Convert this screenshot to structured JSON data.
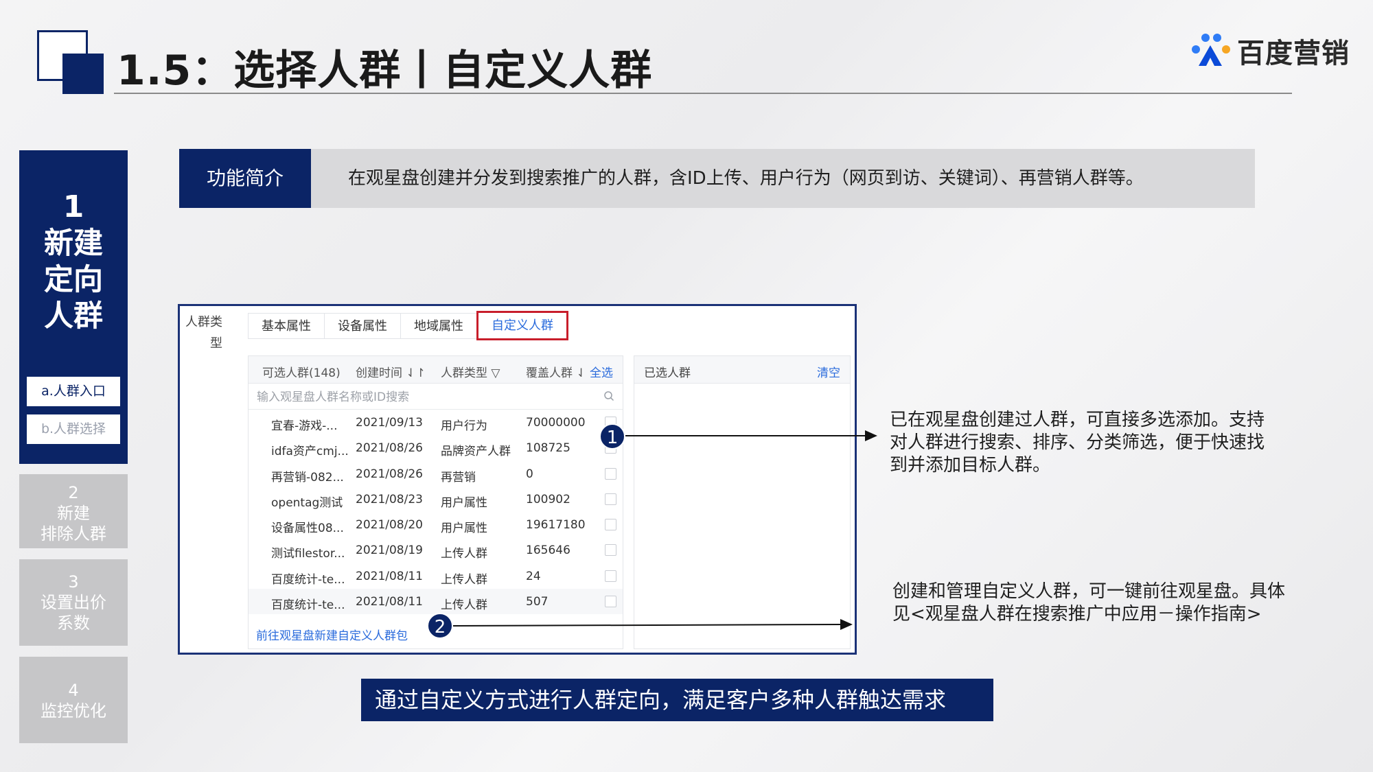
{
  "header": {
    "title": "1.5：选择人群丨自定义人群",
    "brand_text": "百度营销"
  },
  "steps": {
    "active": {
      "number": "1",
      "lines": [
        "新建",
        "定向",
        "人群"
      ]
    },
    "sub_items": [
      "a.人群入口",
      "b.人群选择"
    ],
    "others": [
      {
        "number": "2",
        "lines": [
          "新建",
          "排除人群"
        ]
      },
      {
        "number": "3",
        "lines": [
          "设置出价",
          "系数"
        ]
      },
      {
        "number": "4",
        "lines": [
          "监控优化"
        ]
      }
    ]
  },
  "intro": {
    "label": "功能简介",
    "text": "在观星盘创建并分发到搜索推广的人群，含ID上传、用户行为（网页到访、关键词）、再营销人群等。"
  },
  "panel": {
    "type_label_1": "人群类",
    "type_label_2": "型",
    "tabs": [
      "基本属性",
      "设备属性",
      "地域属性",
      "自定义人群"
    ],
    "active_tab": "自定义人群",
    "list_header": {
      "col1": "可选人群(148)",
      "col2": "创建时间 ⇃↾",
      "col3": "人群类型 ▽",
      "col4": "覆盖人群 ⇃",
      "select_all": "全选"
    },
    "search_placeholder": "输入观星盘人群名称或ID搜索",
    "rows": [
      {
        "name": "宜春-游戏-...",
        "date": "2021/09/13",
        "type": "用户行为",
        "coverage": "70000000"
      },
      {
        "name": "idfa资产cmj...",
        "date": "2021/08/26",
        "type": "品牌资产人群",
        "coverage": "108725"
      },
      {
        "name": "再营销-082...",
        "date": "2021/08/26",
        "type": "再营销",
        "coverage": "0"
      },
      {
        "name": "opentag测试",
        "date": "2021/08/23",
        "type": "用户属性",
        "coverage": "100902"
      },
      {
        "name": "设备属性08...",
        "date": "2021/08/20",
        "type": "用户属性",
        "coverage": "19617180"
      },
      {
        "name": "测试filestor...",
        "date": "2021/08/19",
        "type": "上传人群",
        "coverage": "165646"
      },
      {
        "name": "百度统计-te...",
        "date": "2021/08/11",
        "type": "上传人群",
        "coverage": "24"
      },
      {
        "name": "百度统计-te...",
        "date": "2021/08/11",
        "type": "上传人群",
        "coverage": "507"
      }
    ],
    "go_link": "前往观星盘新建自定义人群包",
    "selected_title": "已选人群",
    "clear_label": "清空"
  },
  "badges": [
    "1",
    "2"
  ],
  "notes": {
    "note1": "已在观星盘创建过人群，可直接多选添加。支持对人群进行搜索、排序、分类筛选，便于快速找到并添加目标人群。",
    "note2": "创建和管理自定义人群，可一键前往观星盘。具体见<观星盘人群在搜索推广中应用－操作指南>"
  },
  "banner": "通过自定义方式进行人群定向，满足客户多种人群触达需求",
  "colors": {
    "navy": "#0b2466",
    "link_blue": "#2a6bdc",
    "highlight_red": "#c81e2b"
  }
}
